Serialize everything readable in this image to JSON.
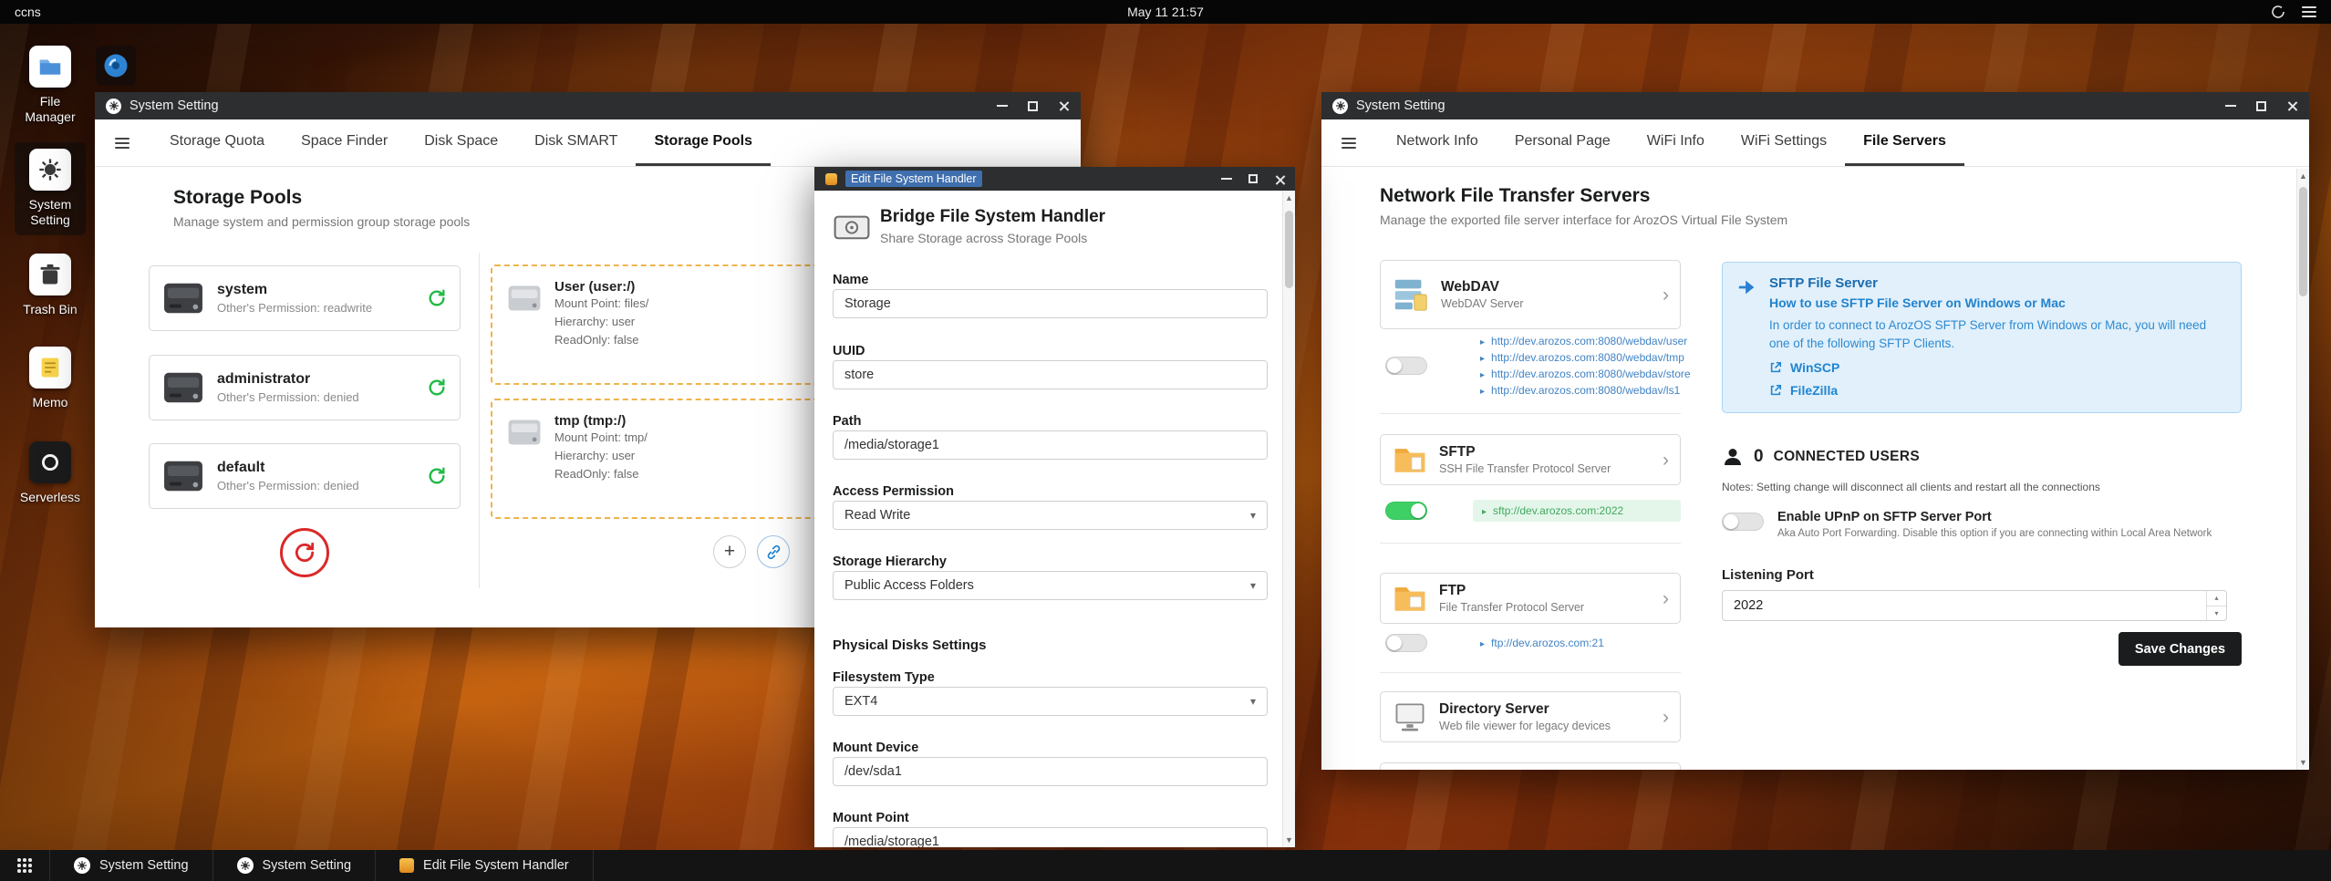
{
  "topbar": {
    "host": "ccns",
    "clock": "May 11 21:57"
  },
  "desktop": {
    "icons": [
      {
        "label": "File Manager"
      },
      {
        "label": "System Setting"
      },
      {
        "label": "Trash Bin"
      },
      {
        "label": "Memo"
      },
      {
        "label": "Serverless"
      }
    ]
  },
  "storage_window": {
    "title": "System Setting",
    "tabs": [
      {
        "label": "Storage Quota"
      },
      {
        "label": "Space Finder"
      },
      {
        "label": "Disk Space"
      },
      {
        "label": "Disk SMART"
      },
      {
        "label": "Storage Pools"
      }
    ],
    "heading": "Storage Pools",
    "subheading": "Manage system and permission group storage pools",
    "pools": [
      {
        "name": "system",
        "permission": "Other's Permission: readwrite"
      },
      {
        "name": "administrator",
        "permission": "Other's Permission: denied"
      },
      {
        "name": "default",
        "permission": "Other's Permission: denied"
      }
    ],
    "mounts": [
      {
        "name": "User (user:/)",
        "mount_point": "Mount Point: files/",
        "hierarchy": "Hierarchy: user",
        "readonly": "ReadOnly: false"
      },
      {
        "name": "tmp (tmp:/)",
        "mount_point": "Mount Point: tmp/",
        "hierarchy": "Hierarchy: user",
        "readonly": "ReadOnly: false"
      }
    ]
  },
  "editor_window": {
    "title": "Edit File System Handler",
    "heading": "Bridge File System Handler",
    "subheading": "Share Storage across Storage Pools",
    "name_label": "Name",
    "name_value": "Storage",
    "uuid_label": "UUID",
    "uuid_value": "store",
    "path_label": "Path",
    "path_value": "/media/storage1",
    "access_label": "Access Permission",
    "access_value": "Read Write",
    "hierarchy_label": "Storage Hierarchy",
    "hierarchy_value": "Public Access Folders",
    "section_label": "Physical Disks Settings",
    "fstype_label": "Filesystem Type",
    "fstype_value": "EXT4",
    "mount_device_label": "Mount Device",
    "mount_device_value": "/dev/sda1",
    "mount_point_label": "Mount Point",
    "mount_point_value": "/media/storage1"
  },
  "servers_window": {
    "title": "System Setting",
    "tabs": [
      {
        "label": "Network Info"
      },
      {
        "label": "Personal Page"
      },
      {
        "label": "WiFi Info"
      },
      {
        "label": "WiFi Settings"
      },
      {
        "label": "File Servers"
      }
    ],
    "heading": "Network File Transfer Servers",
    "subheading": "Manage the exported file server interface for ArozOS Virtual File System",
    "webdav": {
      "name": "WebDAV",
      "desc": "WebDAV Server",
      "links": [
        "http://dev.arozos.com:8080/webdav/user",
        "http://dev.arozos.com:8080/webdav/tmp",
        "http://dev.arozos.com:8080/webdav/store",
        "http://dev.arozos.com:8080/webdav/ls1"
      ]
    },
    "sftp": {
      "name": "SFTP",
      "desc": "SSH File Transfer Protocol Server",
      "link": "sftp://dev.arozos.com:2022"
    },
    "ftp": {
      "name": "FTP",
      "desc": "File Transfer Protocol Server",
      "link": "ftp://dev.arozos.com:21"
    },
    "directory": {
      "name": "Directory Server",
      "desc": "Web file viewer for legacy devices"
    },
    "info": {
      "title": "SFTP File Server",
      "subtitle": "How to use SFTP File Server on Windows or Mac",
      "body": "In order to connect to ArozOS SFTP Server from Windows or Mac, you will need one of the following SFTP Clients.",
      "clients": [
        {
          "label": "WinSCP"
        },
        {
          "label": "FileZilla"
        }
      ]
    },
    "connected": {
      "count": "0",
      "label": "CONNECTED USERS",
      "note": "Notes: Setting change will disconnect all clients and restart all the connections"
    },
    "upnp": {
      "label": "Enable UPnP on SFTP Server Port",
      "desc": "Aka Auto Port Forwarding. Disable this option if you are connecting within Local Area Network"
    },
    "port_label": "Listening Port",
    "port_value": "2022",
    "save_label": "Save Changes"
  },
  "taskbar": {
    "items": [
      {
        "label": "System Setting"
      },
      {
        "label": "System Setting"
      },
      {
        "label": "Edit File System Handler"
      }
    ]
  },
  "icons": {
    "caret_down": "▾",
    "chevron_right": "›",
    "bullet": "▸",
    "scroll_up": "▲",
    "scroll_down": "▼",
    "spin_up": "▴",
    "spin_down": "▾",
    "plus": "+"
  },
  "colors": {
    "toggle_on": "#3fd065",
    "accent_blue": "#2185d0",
    "accent_red": "#db2828",
    "accent_green": "#21ba45",
    "info_bg": "#e1f0fb",
    "save_button_bg": "#1b1c1d"
  }
}
